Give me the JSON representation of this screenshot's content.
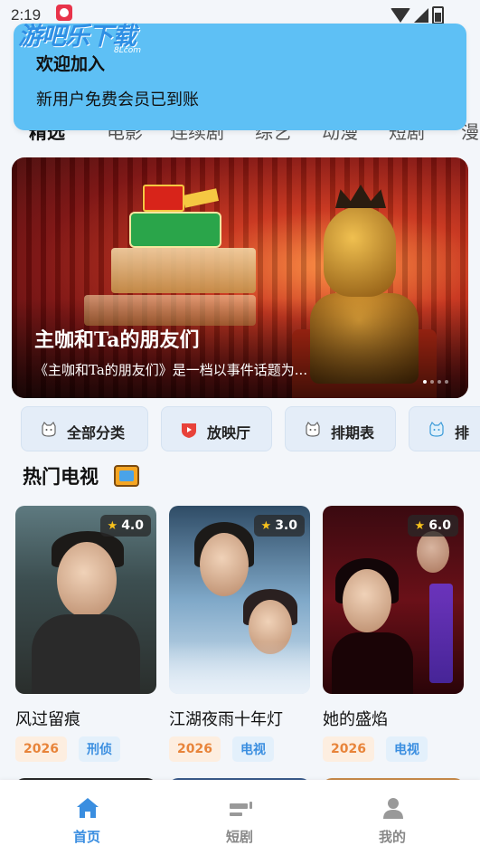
{
  "status_bar": {
    "time": "2:19"
  },
  "watermark": {
    "text": "游吧乐下载",
    "sub": "8Lcom"
  },
  "toast": {
    "title": "欢迎加入",
    "message": "新用户免费会员已到账"
  },
  "tabs": [
    {
      "label": "精选",
      "active": true
    },
    {
      "label": "电影",
      "active": false
    },
    {
      "label": "连续剧",
      "active": false
    },
    {
      "label": "综艺",
      "active": false
    },
    {
      "label": "动漫",
      "active": false
    },
    {
      "label": "短剧",
      "active": false
    },
    {
      "label": "漫",
      "active": false
    }
  ],
  "banner": {
    "title": "主咖和Ta的朋友们",
    "description": "《主咖和Ta的朋友们》是一档以事件话题为...",
    "slide_count": 4,
    "active_slide": 0
  },
  "categories": [
    {
      "label": "全部分类",
      "icon": "cat-face-icon"
    },
    {
      "label": "放映厅",
      "icon": "play-shield-icon"
    },
    {
      "label": "排期表",
      "icon": "cat-face-icon"
    },
    {
      "label": "排",
      "icon": "cat-face-icon"
    }
  ],
  "section": {
    "title": "热门电视",
    "icon": "tv-icon"
  },
  "shows": [
    {
      "title": "风过留痕",
      "rating": "4.0",
      "year": "2026",
      "genre": "刑侦"
    },
    {
      "title": "江湖夜雨十年灯",
      "rating": "3.0",
      "year": "2026",
      "genre": "电视"
    },
    {
      "title": "她的盛焰",
      "rating": "6.0",
      "year": "2026",
      "genre": "电视"
    }
  ],
  "bottom_nav": [
    {
      "label": "首页",
      "icon": "home-icon",
      "active": true
    },
    {
      "label": "短剧",
      "icon": "short-drama-icon",
      "active": false
    },
    {
      "label": "我的",
      "icon": "profile-icon",
      "active": false
    }
  ],
  "colors": {
    "accent": "#3a8ee0",
    "toast_bg": "#5ec0f5",
    "year_tag": "#e8843a",
    "genre_tag": "#3a8ee0",
    "rating_star": "#f8c21c"
  }
}
